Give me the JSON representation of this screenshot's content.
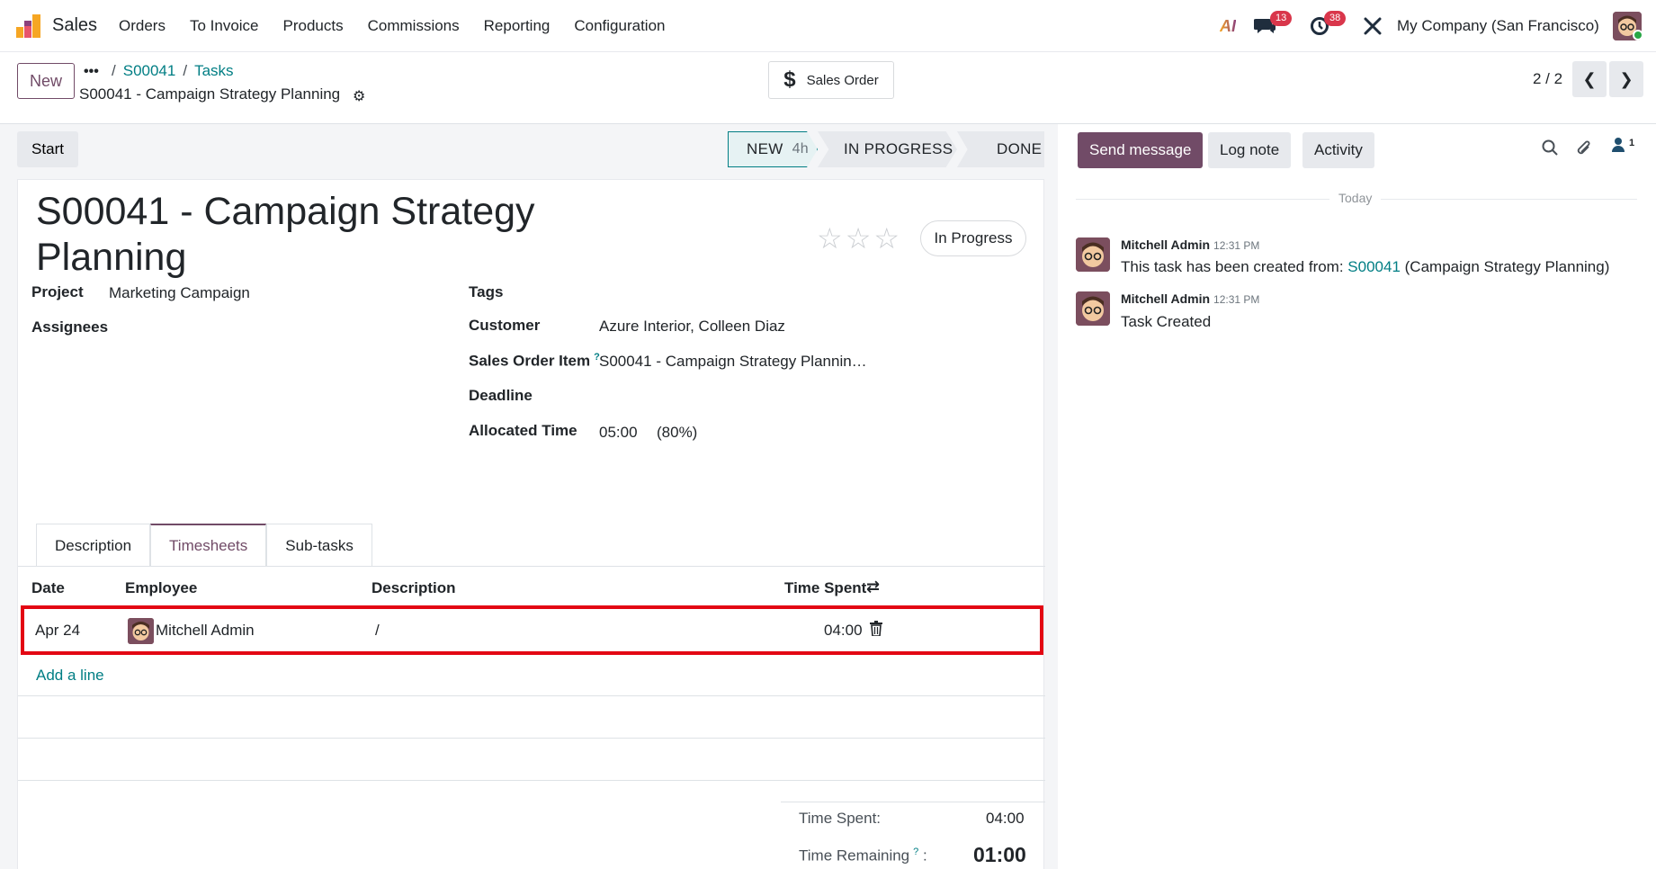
{
  "navbar": {
    "app_name": "Sales",
    "menu": [
      "Orders",
      "To Invoice",
      "Products",
      "Commissions",
      "Reporting",
      "Configuration"
    ],
    "messages_badge": "13",
    "activities_badge": "38",
    "company": "My Company (San Francisco)",
    "ai_label": "AI"
  },
  "control": {
    "new_label": "New",
    "more": "•••",
    "breadcrumb": [
      "S00041",
      "Tasks"
    ],
    "record_title": "S00041 - Campaign Strategy Planning",
    "smart_button": "Sales Order",
    "pager": "2 / 2"
  },
  "statusbar": {
    "start_label": "Start",
    "stages": [
      {
        "name": "NEW",
        "duration": "4h",
        "active": true
      },
      {
        "name": "IN PROGRESS",
        "active": false
      },
      {
        "name": "DONE",
        "active": false
      }
    ]
  },
  "form": {
    "title": "S00041 - Campaign Strategy Planning",
    "stars": "☆☆☆",
    "priority_filled": 0,
    "state": "In Progress",
    "fields": {
      "project_label": "Project",
      "project_value": "Marketing Campaign",
      "assignees_label": "Assignees",
      "tags_label": "Tags",
      "customer_label": "Customer",
      "customer_value": "Azure Interior, Colleen Diaz",
      "so_item_label": "Sales Order Item",
      "so_item_help": "?",
      "so_item_value": "S00041 - Campaign Strategy Plannin…",
      "deadline_label": "Deadline",
      "allocated_label": "Allocated Time",
      "allocated_value": "05:00",
      "allocated_pct": "(80%)"
    },
    "tabs": [
      "Description",
      "Timesheets",
      "Sub-tasks"
    ],
    "active_tab": "Timesheets"
  },
  "timesheets": {
    "columns": [
      "Date",
      "Employee",
      "Description",
      "Time Spent"
    ],
    "rows": [
      {
        "date": "Apr 24",
        "employee": "Mitchell Admin",
        "description": "/",
        "time_spent": "04:00"
      }
    ],
    "add_line": "Add a line",
    "summary": {
      "time_spent_label": "Time Spent:",
      "time_spent_value": "04:00",
      "remaining_label": "Time Remaining",
      "remaining_help": "?",
      "remaining_colon": ":",
      "remaining_value": "01:00"
    }
  },
  "chatter": {
    "send_message": "Send message",
    "log_note": "Log note",
    "activity": "Activity",
    "followers_count": "1",
    "date_separator": "Today",
    "messages": [
      {
        "author": "Mitchell Admin",
        "time": "12:31 PM",
        "body_prefix": "This task has been created from: ",
        "link": "S00041",
        "body_suffix": " (Campaign Strategy Planning)"
      },
      {
        "author": "Mitchell Admin",
        "time": "12:31 PM",
        "body": "Task Created"
      }
    ]
  },
  "colors": {
    "brand": "#714b67",
    "link": "#017e84",
    "highlight": "#e30613",
    "badge": "#d9364b"
  }
}
